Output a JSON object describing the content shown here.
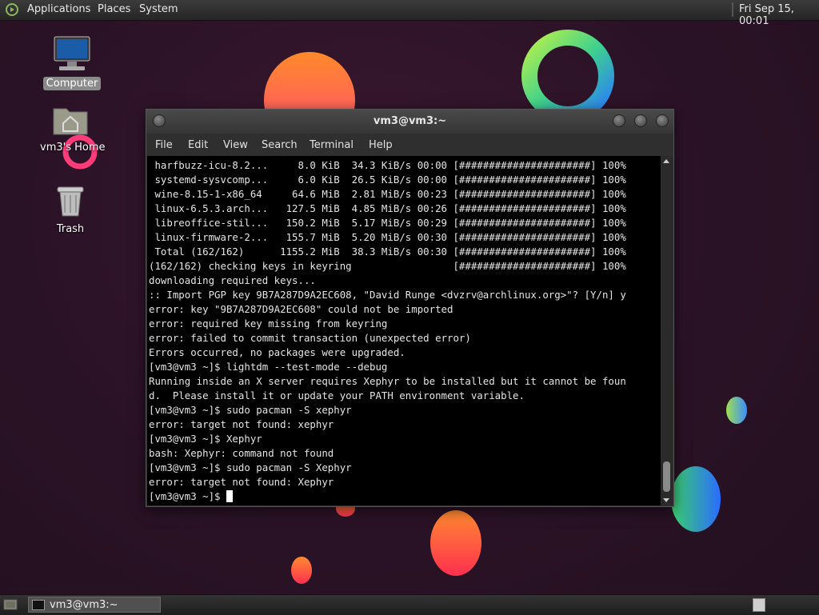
{
  "top_panel": {
    "menus": [
      "Applications",
      "Places",
      "System"
    ],
    "clock": "Fri Sep 15, 00:01"
  },
  "desktop": {
    "icons": [
      {
        "label": "Computer",
        "icon": "computer-icon"
      },
      {
        "label": "vm3's Home",
        "icon": "home-folder-icon"
      },
      {
        "label": "Trash",
        "icon": "trash-icon"
      }
    ]
  },
  "terminal": {
    "title": "vm3@vm3:~",
    "menu": [
      "File",
      "Edit",
      "View",
      "Search",
      "Terminal",
      "Help"
    ],
    "lines": [
      " harfbuzz-icu-8.2...     8.0 KiB  34.3 KiB/s 00:00 [######################] 100%",
      " systemd-sysvcomp...     6.0 KiB  26.5 KiB/s 00:00 [######################] 100%",
      " wine-8.15-1-x86_64     64.6 MiB  2.81 MiB/s 00:23 [######################] 100%",
      " linux-6.5.3.arch...   127.5 MiB  4.85 MiB/s 00:26 [######################] 100%",
      " libreoffice-stil...   150.2 MiB  5.17 MiB/s 00:29 [######################] 100%",
      " linux-firmware-2...   155.7 MiB  5.20 MiB/s 00:30 [######################] 100%",
      " Total (162/162)      1155.2 MiB  38.3 MiB/s 00:30 [######################] 100%",
      "(162/162) checking keys in keyring                 [######################] 100%",
      "downloading required keys...",
      ":: Import PGP key 9B7A287D9A2EC608, \"David Runge <dvzrv@archlinux.org>\"? [Y/n] y",
      "error: key \"9B7A287D9A2EC608\" could not be imported",
      "error: required key missing from keyring",
      "error: failed to commit transaction (unexpected error)",
      "Errors occurred, no packages were upgraded.",
      "[vm3@vm3 ~]$ lightdm --test-mode --debug",
      "Running inside an X server requires Xephyr to be installed but it cannot be foun",
      "d.  Please install it or update your PATH environment variable.",
      "[vm3@vm3 ~]$ sudo pacman -S xephyr",
      "error: target not found: xephyr",
      "[vm3@vm3 ~]$ Xephyr",
      "bash: Xephyr: command not found",
      "[vm3@vm3 ~]$ sudo pacman -S Xephyr",
      "error: target not found: Xephyr"
    ],
    "prompt": "[vm3@vm3 ~]$ "
  },
  "taskbar": {
    "task_label": "vm3@vm3:~"
  },
  "colors": {
    "desktop_bg": "#2a1226",
    "terminal_bg": "#000000",
    "terminal_fg": "#e4e4e4"
  }
}
